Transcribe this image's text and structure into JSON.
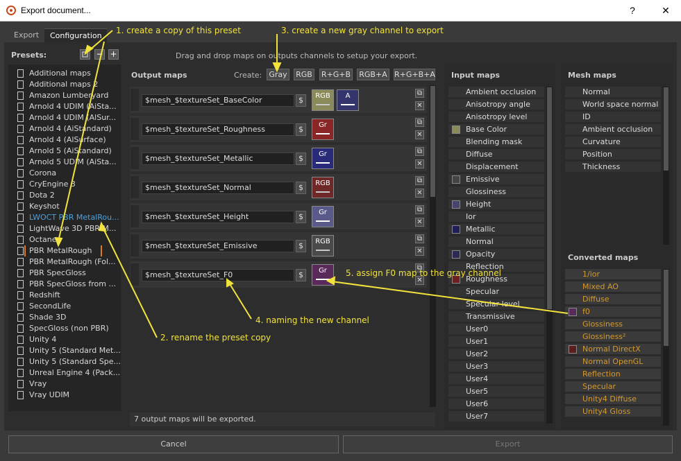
{
  "window": {
    "title": "Export document...",
    "help_label": "?",
    "close_label": "✕"
  },
  "tabs": [
    "Export",
    "Configuration"
  ],
  "presets": {
    "label": "Presets:",
    "add_label": "+",
    "remove_label": "−",
    "items": [
      "Additional maps",
      "Additional maps 2",
      "Amazon Lumberyard",
      "Arnold 4  UDIM (AiSta...",
      "Arnold 4  UDIM (AlSur...",
      "Arnold 4 (AiStandard)",
      "Arnold 4 (AlSurface)",
      "Arnold 5 (AiStandard)",
      "Arnold 5 UDIM (AiSta...",
      "Corona",
      "CryEngine 3",
      "Dota 2",
      "Keyshot",
      "LWOCT PBR MetalRou...",
      "LightWave 3D PBR M...",
      "Octane",
      "PBR MetalRough",
      "PBR MetalRough (Fol...",
      "PBR SpecGloss",
      "PBR SpecGloss from ...",
      "Redshift",
      "SecondLife",
      "Shade 3D",
      "SpecGloss (non PBR)",
      "Unity 4",
      "Unity 5 (Standard Met...",
      "Unity 5 (Standard Spe...",
      "Unreal Engine 4 (Pack...",
      "Vray",
      "Vray UDIM"
    ]
  },
  "hint": "Drag and drop maps on outputs channels to setup your export.",
  "output": {
    "title": "Output maps",
    "create_label": "Create:",
    "create_buttons": [
      "Gray",
      "RGB",
      "R+G+B",
      "RGB+A",
      "R+G+B+A"
    ],
    "rows": [
      {
        "name": "$mesh_$textureSet_BaseColor",
        "channels": [
          {
            "label": "RGB",
            "color": "#8a8a5a",
            "bar": "#c8c8c8"
          },
          {
            "label": "A",
            "color": "#35356e",
            "bar": "#ffffff"
          }
        ]
      },
      {
        "name": "$mesh_$textureSet_Roughness",
        "channels": [
          {
            "label": "Gr",
            "color": "#8a2626",
            "bar": "#ffffff"
          }
        ]
      },
      {
        "name": "$mesh_$textureSet_Metallic",
        "channels": [
          {
            "label": "Gr",
            "color": "#2a2a7a",
            "bar": "#ffffff"
          }
        ]
      },
      {
        "name": "$mesh_$textureSet_Normal",
        "channels": [
          {
            "label": "RGB",
            "color": "#6e2828",
            "bar": "#c8c8c8"
          }
        ]
      },
      {
        "name": "$mesh_$textureSet_Height",
        "channels": [
          {
            "label": "Gr",
            "color": "#5a5a8a",
            "bar": "#ffffff"
          }
        ]
      },
      {
        "name": "$mesh_$textureSet_Emissive",
        "channels": [
          {
            "label": "RGB",
            "color": "#4a4a4a",
            "bar": "#c8c8c8"
          }
        ]
      },
      {
        "name": "$mesh_$textureSet_F0",
        "channels": [
          {
            "label": "Gr",
            "color": "#5a2a5a",
            "bar": "#ffffff"
          }
        ]
      }
    ],
    "dollar_label": "$",
    "status": "7 output maps will be exported."
  },
  "input": {
    "title": "Input maps",
    "items": [
      {
        "label": "Ambient occlusion",
        "color": ""
      },
      {
        "label": "Anisotropy angle",
        "color": ""
      },
      {
        "label": "Anisotropy level",
        "color": ""
      },
      {
        "label": "Base Color",
        "color": "#8a8a5a"
      },
      {
        "label": "Blending mask",
        "color": ""
      },
      {
        "label": "Diffuse",
        "color": ""
      },
      {
        "label": "Displacement",
        "color": ""
      },
      {
        "label": "Emissive",
        "color": "#444444"
      },
      {
        "label": "Glossiness",
        "color": ""
      },
      {
        "label": "Height",
        "color": "#45456e"
      },
      {
        "label": "Ior",
        "color": ""
      },
      {
        "label": "Metallic",
        "color": "#1e1e5a"
      },
      {
        "label": "Normal",
        "color": ""
      },
      {
        "label": "Opacity",
        "color": "#2a2a55"
      },
      {
        "label": "Reflection",
        "color": ""
      },
      {
        "label": "Roughness",
        "color": "#6e2020"
      },
      {
        "label": "Specular",
        "color": ""
      },
      {
        "label": "Specular level",
        "color": ""
      },
      {
        "label": "Transmissive",
        "color": ""
      },
      {
        "label": "User0",
        "color": ""
      },
      {
        "label": "User1",
        "color": ""
      },
      {
        "label": "User2",
        "color": ""
      },
      {
        "label": "User3",
        "color": ""
      },
      {
        "label": "User4",
        "color": ""
      },
      {
        "label": "User5",
        "color": ""
      },
      {
        "label": "User6",
        "color": ""
      },
      {
        "label": "User7",
        "color": ""
      }
    ]
  },
  "mesh": {
    "title": "Mesh maps",
    "items": [
      "Normal",
      "World space normal",
      "ID",
      "Ambient occlusion",
      "Curvature",
      "Position",
      "Thickness"
    ]
  },
  "converted": {
    "title": "Converted maps",
    "items": [
      {
        "label": "1/ior",
        "color": ""
      },
      {
        "label": "Mixed AO",
        "color": ""
      },
      {
        "label": "Diffuse",
        "color": ""
      },
      {
        "label": "f0",
        "color": "#5a2a5a"
      },
      {
        "label": "Glossiness",
        "color": ""
      },
      {
        "label": "Glossiness²",
        "color": ""
      },
      {
        "label": "Normal DirectX",
        "color": "#5a1e1e"
      },
      {
        "label": "Normal OpenGL",
        "color": ""
      },
      {
        "label": "Reflection",
        "color": ""
      },
      {
        "label": "Specular",
        "color": ""
      },
      {
        "label": "Unity4 Diffuse",
        "color": ""
      },
      {
        "label": "Unity4 Gloss",
        "color": ""
      }
    ]
  },
  "buttons": {
    "cancel": "Cancel",
    "export": "Export"
  },
  "annotations": {
    "a1": "1. create a copy of this preset",
    "a2": "2. rename the preset copy",
    "a3": "3. create a new gray channel to export",
    "a4": "4. naming the new channel",
    "a5": "5. assign F0 map to the gray channel"
  },
  "colors": {
    "annotation": "#f2e33c",
    "highlight_box": "#e07a1a",
    "selected_text": "#4aa3df",
    "converted_text": "#d69a2c"
  }
}
